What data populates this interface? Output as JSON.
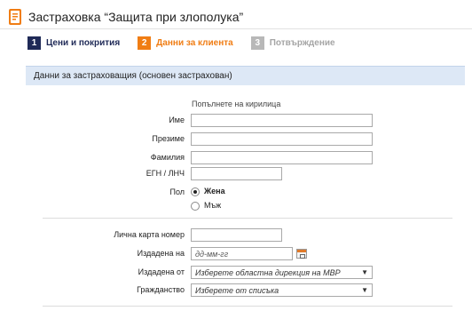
{
  "header": {
    "title": "Застраховка “Защита при злополука”",
    "logo_icon": "document-icon"
  },
  "steps": [
    {
      "number": "1",
      "label": "Цени и покрития"
    },
    {
      "number": "2",
      "label": "Данни за клиента"
    },
    {
      "number": "3",
      "label": "Потвърждение"
    }
  ],
  "section": {
    "title": "Данни за застраховащия (основен застрахован)"
  },
  "form": {
    "hint": "Попълнете на кирилица",
    "first_name_label": "Име",
    "middle_name_label": "Презиме",
    "last_name_label": "Фамилия",
    "egn_label": "ЕГН / ЛНЧ",
    "sex_label": "Пол",
    "sex_female": "Жена",
    "sex_male": "Мъж",
    "id_card_label": "Лична карта номер",
    "issued_on_label": "Издадена на",
    "issued_on_placeholder": "дд-мм-гг",
    "issued_by_label": "Издадена от",
    "issued_by_value": "Изберете областна дирекция на МВР",
    "citizenship_label": "Гражданство",
    "citizenship_value": "Изберете от списъка"
  },
  "colors": {
    "accent": "#f07d14",
    "primary": "#1f2a57",
    "section_bg": "#dde8f6"
  }
}
